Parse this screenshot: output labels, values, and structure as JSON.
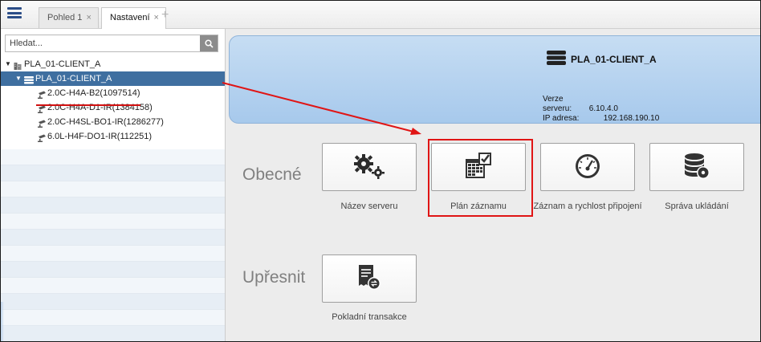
{
  "menu": {
    "icon": "hamburger-menu-icon"
  },
  "tabs": [
    {
      "label": "Pohled 1",
      "close": "×",
      "active": false
    },
    {
      "label": "Nastavení",
      "close": "×",
      "active": true
    }
  ],
  "add_tab": "+",
  "search": {
    "placeholder": "Hledat...",
    "value": "",
    "icon": "search-icon"
  },
  "tree": {
    "root": {
      "label": "PLA_01-CLIENT_A",
      "icon": "building-icon"
    },
    "server": {
      "label": "PLA_01-CLIENT_A",
      "icon": "server-icon"
    },
    "cameras": [
      {
        "label": "2.0C-H4A-B2(1097514)"
      },
      {
        "label": "2.0C-H4A-D1-IR(1384158)"
      },
      {
        "label": "2.0C-H4SL-BO1-IR(1286277)"
      },
      {
        "label": "6.0L-H4F-DO1-IR(112251)"
      }
    ]
  },
  "server_info": {
    "name": "PLA_01-CLIENT_A",
    "version_label": "Verze serveru:",
    "version": "6.10.4.0",
    "ip_label": "IP adresa:",
    "ip": "192.168.190.10"
  },
  "sections": {
    "general": "Obecné",
    "advanced": "Upřesnit"
  },
  "cards": {
    "server_name": "Název serveru",
    "recording_schedule": "Plán záznamu",
    "recording_speed": "Záznam a rychlost připojení",
    "storage": "Správa ukládání",
    "pos": "Pokladní transakce"
  },
  "colors": {
    "accent": "#3f6fa0",
    "highlight": "#e01515",
    "banner": "#b8d4f0"
  }
}
